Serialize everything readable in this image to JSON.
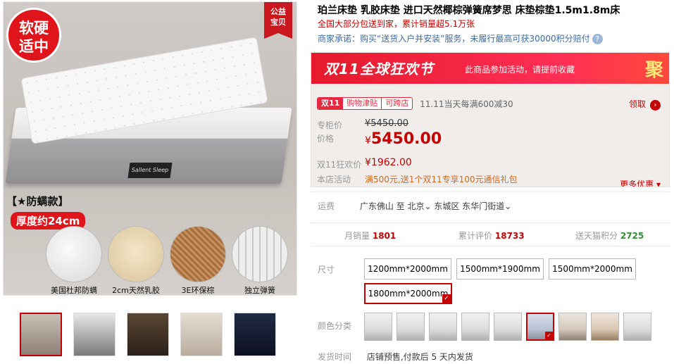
{
  "gallery": {
    "public_badge": [
      "公益",
      "宝贝"
    ],
    "firmness_badge": [
      "软硬",
      "适中"
    ],
    "anti_mite": "【★防螨款】",
    "thickness": "厚度约24cm",
    "mattress_label": "Sallent Sleep",
    "features": [
      "美国杜邦防螨",
      "2cm天然乳胶",
      "3E环保棕",
      "独立弹簧"
    ],
    "thumbs_count": 5
  },
  "product": {
    "title": "珀兰床垫 乳胶床垫 进口天然椰棕弹簧席梦思 床垫棕垫1.5m1.8m床",
    "subtitle": "全国大部分包送到家，累计销量超5.1万张",
    "promise": "商家承诺：购买“送货入户并安装”服务，未履行最高可获30000积分赔付",
    "promise_help": "?"
  },
  "promo": {
    "banner_logo": "双11全球狂欢节",
    "banner_text": "此商品参加活动，请提前收藏",
    "banner_ju": "聚",
    "coupon_tag_1": "双11",
    "coupon_tag_2": "购物津贴",
    "coupon_tag_3": "可跨店",
    "coupon_text": "11.11当天每满600减30",
    "claim": "领取",
    "claim_icon": "›",
    "list_price_label": "专柜价",
    "list_price": "¥5450.00",
    "price_label": "价格",
    "price_symbol": "¥",
    "price": "5450.00",
    "sale_label": "双11狂欢价",
    "sale_symbol": "¥",
    "sale_price": "1962.00",
    "activity_label": "本店活动",
    "activity_text": "满500元,送1个双11专享100元通信礼包",
    "more": "更多优惠 ▾"
  },
  "shipping": {
    "label": "运费",
    "origin": "广东佛山",
    "to": "至",
    "dest_1": "北京",
    "dest_2": "东城区",
    "dest_3": "东华门街道"
  },
  "stats": {
    "monthly_label": "月销量",
    "monthly_value": "1801",
    "reviews_label": "累计评价",
    "reviews_value": "18733",
    "points_label": "送天猫积分",
    "points_value": "2725"
  },
  "options": {
    "size_label": "尺寸",
    "sizes": [
      "1200mm*2000mm",
      "1500mm*1900mm",
      "1500mm*2000mm",
      "1800mm*2000mm"
    ],
    "selected_size": "1800mm*2000mm",
    "color_label": "颜色分类",
    "color_count": 10,
    "selected_color_index": 5
  },
  "delivery": {
    "label": "发货时间",
    "text": "店铺预售,付款后 5 天内发货"
  },
  "colors": {
    "accent": "#c40000",
    "banner": "#e51a2b",
    "link": "#3c6b9e"
  }
}
